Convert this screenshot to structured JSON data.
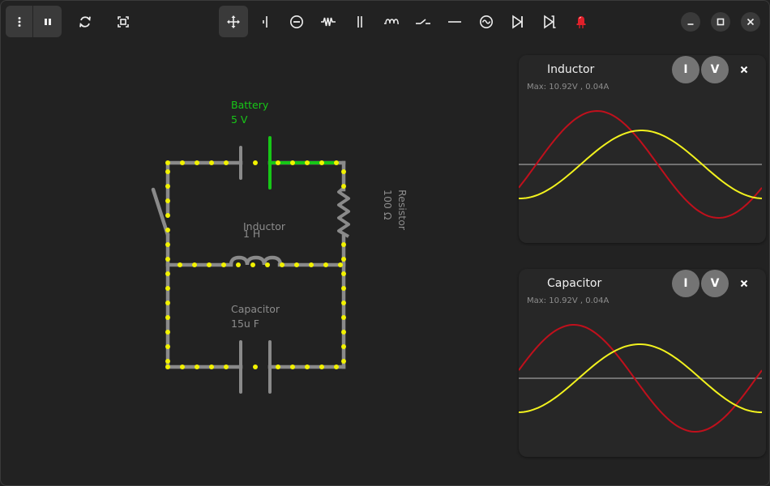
{
  "window": {
    "header_icons": [
      "menu-icon",
      "pause-icon",
      "reset-icon",
      "fit-view-icon"
    ],
    "controls": [
      "minimize-icon",
      "maximize-icon",
      "close-icon"
    ]
  },
  "toolbar": {
    "tools": [
      "move",
      "wire",
      "ammeter",
      "resistor",
      "capacitor",
      "inductor",
      "switch",
      "wire-line",
      "ac-source",
      "diode",
      "zener-diode",
      "led"
    ],
    "active_tool": "move",
    "led_color": "#e0202a"
  },
  "circuit": {
    "battery": {
      "name": "Battery",
      "value": "5 V",
      "color": "#17c717"
    },
    "resistor": {
      "name": "Resistor",
      "value": "100 Ω"
    },
    "inductor": {
      "name": "Inductor",
      "value": "1 H"
    },
    "capacitor": {
      "name": "Capacitor",
      "value": "15u F"
    },
    "wire_color": "#8a8a8a",
    "electron_color": "#f2f200"
  },
  "panels": [
    {
      "title": "Inductor",
      "max": "Max: 10.92V , 0.04A",
      "btn_current": "I",
      "btn_voltage": "V",
      "current_color": "#f2f21e",
      "voltage_color": "#c0101c"
    },
    {
      "title": "Capacitor",
      "max": "Max: 10.92V , 0.04A",
      "btn_current": "I",
      "btn_voltage": "V",
      "current_color": "#f2f21e",
      "voltage_color": "#c0101c"
    }
  ]
}
